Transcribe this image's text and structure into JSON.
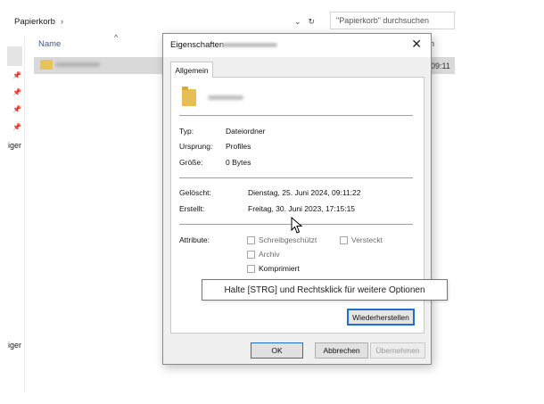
{
  "explorer": {
    "breadcrumb": "Papierkorb",
    "breadcrumb_sep": "›",
    "dropdown_glyph": "⌄",
    "refresh_glyph": "↻",
    "search_placeholder": "\"Papierkorb\" durchsuchen",
    "column_name": "Name",
    "sort_glyph": "^",
    "column_right": "n",
    "row_time": "09:11",
    "sidebar_labels": [
      "iger",
      "iger"
    ],
    "pin_glyph": "📌"
  },
  "dialog": {
    "title": "Eigenschaften",
    "close_glyph": "✕",
    "tab_general": "Allgemein",
    "fields": {
      "type_label": "Typ:",
      "type_value": "Dateiordner",
      "origin_label": "Ursprung:",
      "origin_value": "Profiles",
      "size_label": "Größe:",
      "size_value": "0 Bytes",
      "deleted_label": "Gelöscht:",
      "deleted_value": "Dienstag, 25. Juni 2024, 09:11:22",
      "created_label": "Erstellt:",
      "created_value": "Freitag, 30. Juni 2023, 17:15:15",
      "attributes_label": "Attribute:"
    },
    "attributes": {
      "readonly": "Schreibgeschützt",
      "hidden": "Versteckt",
      "archive": "Archiv",
      "compressed": "Komprimiert"
    },
    "restore_button": "Wiederherstellen",
    "ok_button": "OK",
    "cancel_button": "Abbrechen",
    "apply_button": "Übernehmen"
  },
  "tooltip": {
    "text": "Halte [STRG] und Rechtsklick für weitere Optionen"
  },
  "colors": {
    "accent": "#1e6fd0",
    "folder": "#e6be55",
    "selection": "#d9d9d9"
  }
}
